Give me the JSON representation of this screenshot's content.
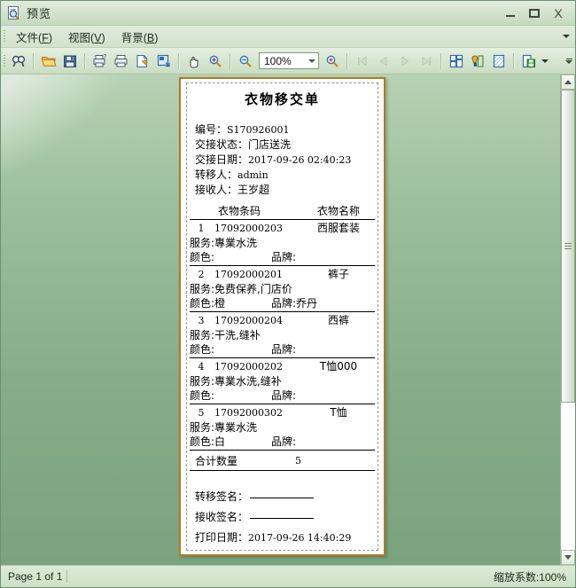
{
  "window": {
    "title": "预览",
    "icon": "preview-magnifier-icon",
    "minimize_label": "",
    "maximize_label": "",
    "close_label": "X"
  },
  "menubar": {
    "items": [
      {
        "text": "文件",
        "accel": "F"
      },
      {
        "text": "视图",
        "accel": "V"
      },
      {
        "text": "背景",
        "accel": "B"
      }
    ]
  },
  "toolbar": {
    "zoom_value": "100%",
    "buttons": [
      {
        "name": "find-icon",
        "enabled": true
      },
      {
        "name": "open-folder-icon",
        "enabled": true
      },
      {
        "name": "save-icon",
        "enabled": true
      },
      {
        "name": "print-setup-icon",
        "enabled": true
      },
      {
        "name": "print-icon",
        "enabled": true
      },
      {
        "name": "page-setup-icon",
        "enabled": true
      },
      {
        "name": "fit-page-icon",
        "enabled": true
      },
      {
        "name": "hand-pan-icon",
        "enabled": true
      },
      {
        "name": "zoom-in-icon",
        "enabled": true
      },
      {
        "name": "zoom-out-icon",
        "enabled": true
      },
      {
        "name": "zoom-magnifier-icon",
        "enabled": true
      },
      {
        "name": "first-page-icon",
        "enabled": false
      },
      {
        "name": "prev-page-icon",
        "enabled": false
      },
      {
        "name": "next-page-icon",
        "enabled": false
      },
      {
        "name": "last-page-icon",
        "enabled": false
      },
      {
        "name": "multi-page-icon",
        "enabled": true
      },
      {
        "name": "background-color-icon",
        "enabled": true
      },
      {
        "name": "watermark-icon",
        "enabled": true
      },
      {
        "name": "export-save-icon",
        "enabled": true
      }
    ]
  },
  "document": {
    "title": "衣物移交单",
    "meta": [
      {
        "label": "编号：",
        "value": "S170926001",
        "cjk": false
      },
      {
        "label": "交接状态：",
        "value": "门店送洗",
        "cjk": true
      },
      {
        "label": "交接日期：",
        "value": "2017-09-26 02:40:23",
        "cjk": false
      },
      {
        "label": "转移人：",
        "value": "admin",
        "cjk": false
      },
      {
        "label": "接收人：",
        "value": "王岁超",
        "cjk": true
      }
    ],
    "table_headers": {
      "index": "",
      "code": "衣物条码",
      "name": "衣物名称"
    },
    "rows": [
      {
        "index": "1",
        "code": "17092000203",
        "name": "西服套装",
        "service": "服务:專業水洗",
        "color_label": "颜色:",
        "color_value": "",
        "brand_label": "品牌:",
        "brand_value": ""
      },
      {
        "index": "2",
        "code": "17092000201",
        "name": "裤子",
        "service": "服务:免费保养,门店价",
        "color_label": "颜色:",
        "color_value": "橙",
        "brand_label": "品牌:",
        "brand_value": "乔丹"
      },
      {
        "index": "3",
        "code": "17092000204",
        "name": "西裤",
        "service": "服务:干洗,缝补",
        "color_label": "颜色:",
        "color_value": "",
        "brand_label": "品牌:",
        "brand_value": ""
      },
      {
        "index": "4",
        "code": "17092000202",
        "name": "T恤000",
        "service": "服务:專業水洗,缝补",
        "color_label": "颜色:",
        "color_value": "",
        "brand_label": "品牌:",
        "brand_value": ""
      },
      {
        "index": "5",
        "code": "17092000302",
        "name": "T恤",
        "service": "服务:專業水洗",
        "color_label": "颜色:",
        "color_value": "白",
        "brand_label": "品牌:",
        "brand_value": ""
      }
    ],
    "total": {
      "label": "合计数量",
      "value": "5"
    },
    "signatures": [
      {
        "label": "转移签名：",
        "blank": true
      },
      {
        "label": "接收签名：",
        "blank": true
      }
    ],
    "print_date": {
      "label": "打印日期：",
      "value": "2017-09-26 14:40:29"
    }
  },
  "statusbar": {
    "page_info": "Page 1 of 1",
    "zoom_info": "缩放系数:100%"
  },
  "colors": {
    "window_bg": "#cfe0cb",
    "workarea_green": "#8cb391",
    "page_border": "#b07a20",
    "text": "#1d2a1d"
  }
}
